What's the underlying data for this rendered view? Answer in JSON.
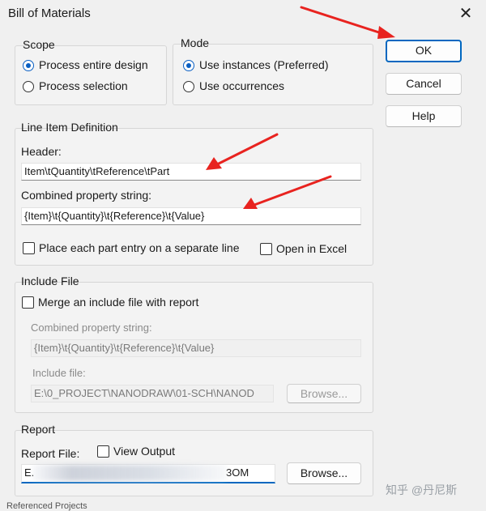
{
  "window": {
    "title": "Bill of Materials",
    "close_glyph": "✕"
  },
  "scope": {
    "label": "Scope",
    "options": [
      "Process entire design",
      "Process selection"
    ],
    "selected": 0
  },
  "mode": {
    "label": "Mode",
    "options": [
      "Use instances (Preferred)",
      "Use occurrences"
    ],
    "selected": 0
  },
  "line_item": {
    "label": "Line Item Definition",
    "header_label": "Header:",
    "header_value": "Item\\tQuantity\\tReference\\tPart",
    "combined_label": "Combined property string:",
    "combined_value": "{Item}\\t{Quantity}\\t{Reference}\\t{Value}",
    "separate_line_label": "Place each part entry on a separate line",
    "open_excel_label": "Open in Excel"
  },
  "include_file": {
    "label": "Include File",
    "merge_label": "Merge an include file with report",
    "combined_label": "Combined property string:",
    "combined_value": "{Item}\\t{Quantity}\\t{Reference}\\t{Value}",
    "include_label": "Include file:",
    "include_value": "E:\\0_PROJECT\\NANODRAW\\01-SCH\\NANOD",
    "browse_label": "Browse..."
  },
  "report": {
    "label": "Report",
    "file_label": "Report File:",
    "view_output_label": "View Output",
    "file_value_start": "E.",
    "file_value_end": "3OM",
    "browse_label": "Browse..."
  },
  "buttons": {
    "ok": "OK",
    "cancel": "Cancel",
    "help": "Help"
  },
  "watermark": "知乎 @丹尼斯",
  "footer_text": "Referenced Projects",
  "annotation_color": "#e8231f",
  "accent_color": "#0067c0"
}
